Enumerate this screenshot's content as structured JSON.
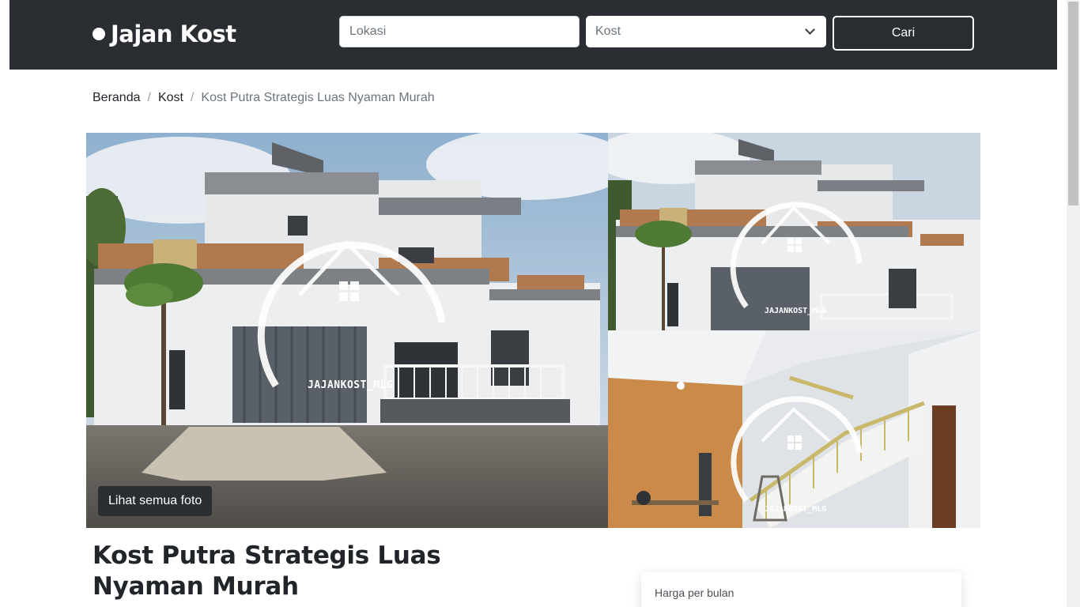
{
  "brand": {
    "name": "Jajan Kost"
  },
  "search": {
    "location_placeholder": "Lokasi",
    "location_value": "",
    "type_selected": "Kost",
    "submit_label": "Cari"
  },
  "breadcrumb": [
    {
      "label": "Beranda"
    },
    {
      "label": "Kost"
    },
    {
      "label": "Kost Putra Strategis Luas Nyaman Murah"
    }
  ],
  "gallery": {
    "watermark": "JAJANKOST_MLG",
    "view_all_label": "Lihat semua foto"
  },
  "listing": {
    "title": "Kost Putra Strategis Luas Nyaman Murah",
    "price_label": "Harga per bulan"
  },
  "colors": {
    "navbar": "#2a2d31",
    "text": "#212529",
    "muted": "#6c757d"
  }
}
